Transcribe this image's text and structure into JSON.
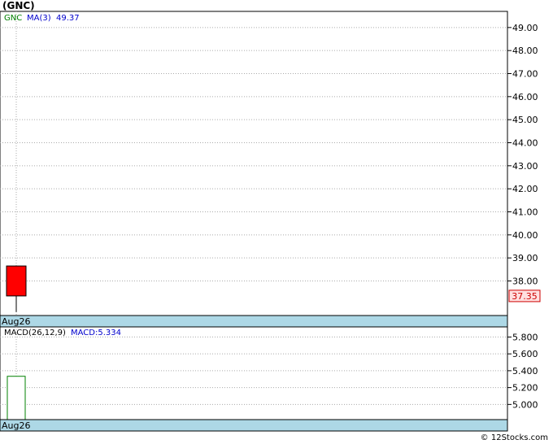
{
  "title": "(GNC)",
  "copyright": "© 12Stocks.com",
  "chart_data": [
    {
      "type": "candlestick",
      "legend": {
        "symbol": "GNC",
        "ma_label": "MA(3)",
        "ma_value": "49.37"
      },
      "ylim": [
        36.5,
        49.7
      ],
      "yticks": [
        "49.00",
        "48.00",
        "47.00",
        "46.00",
        "45.00",
        "44.00",
        "43.00",
        "42.00",
        "41.00",
        "40.00",
        "39.00",
        "38.00"
      ],
      "ytick_values": [
        49,
        48,
        47,
        46,
        45,
        44,
        43,
        42,
        41,
        40,
        39,
        38
      ],
      "last_price": "37.35",
      "last_price_value": 37.35,
      "x_label": "Aug26",
      "candles": [
        {
          "date": "Aug26",
          "open": 38.65,
          "close": 37.35,
          "high": 38.65,
          "low": 36.65,
          "color": "#ff0000"
        }
      ]
    },
    {
      "type": "macd",
      "legend": {
        "label": "MACD(26,12,9)",
        "macd_label": "MACD:5.334"
      },
      "ylim": [
        4.82,
        5.92
      ],
      "yticks": [
        "5.800",
        "5.600",
        "5.400",
        "5.200",
        "5.000"
      ],
      "ytick_values": [
        5.8,
        5.6,
        5.4,
        5.2,
        5.0
      ],
      "x_label": "Aug26",
      "bars": [
        {
          "date": "Aug26",
          "top": 5.334,
          "bottom": 4.82,
          "color": "#ffffff",
          "border": "#008000"
        }
      ]
    }
  ],
  "colors": {
    "grid": "#aaaaaa",
    "axis_band": "#add8e6",
    "symbol": "#008000",
    "ma": "#0000cc",
    "price_box": "#ffe0e0",
    "price_text": "#cc0000"
  }
}
